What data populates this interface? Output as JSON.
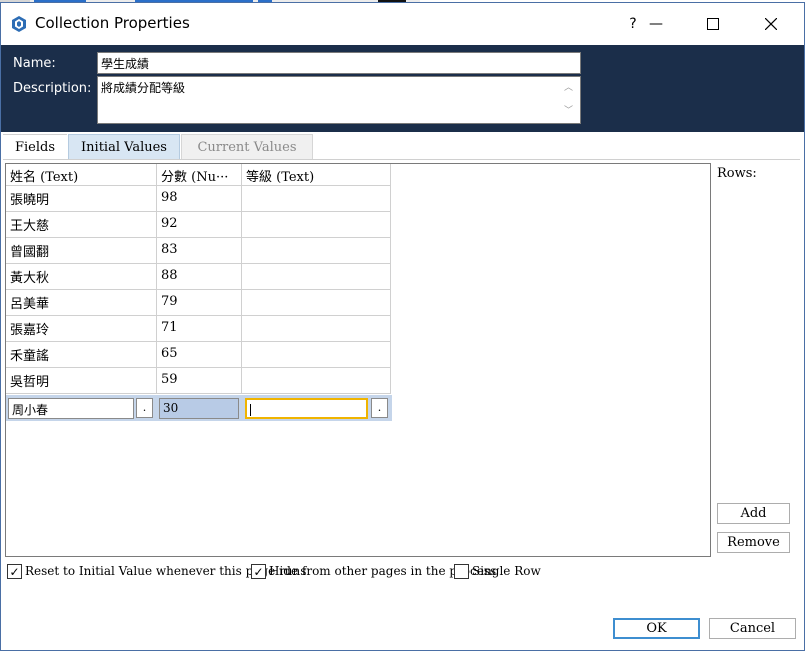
{
  "window": {
    "title": "Collection Properties",
    "help_label": "?",
    "minimize_glyph": "—",
    "maximize_glyph": "☐",
    "close_glyph": "✕"
  },
  "header": {
    "name_label": "Name:",
    "name_value": "學生成績",
    "description_label": "Description:",
    "description_value": "將成績分配等級"
  },
  "tabs": [
    {
      "label": "Fields",
      "state": "normal"
    },
    {
      "label": "Initial Values",
      "state": "selected"
    },
    {
      "label": "Current Values",
      "state": "disabled"
    }
  ],
  "grid": {
    "columns": [
      "姓名 (Text)",
      "分數 (Nu···",
      "等級 (Text)"
    ],
    "rows": [
      [
        "張曉明",
        "98",
        ""
      ],
      [
        "王大慈",
        "92",
        ""
      ],
      [
        "曾國翻",
        "83",
        ""
      ],
      [
        "黃大秋",
        "88",
        ""
      ],
      [
        "呂美華",
        "79",
        ""
      ],
      [
        "張嘉玲",
        "71",
        ""
      ],
      [
        "禾童謠",
        "65",
        ""
      ],
      [
        "吳哲明",
        "59",
        ""
      ]
    ],
    "edit_row": [
      "周小春",
      "30",
      ""
    ],
    "ellipsis_button_label": "."
  },
  "side": {
    "rows_label": "Rows:",
    "add_label": "Add",
    "remove_label": "Remove"
  },
  "options": {
    "reset_label": "Reset to Initial Value whenever this page runs",
    "reset_checked": true,
    "hide_label": "Hide from other pages in the process",
    "hide_checked": true,
    "single_row_label": "Single Row",
    "single_row_checked": false,
    "check_glyph": "✓"
  },
  "footer": {
    "ok_label": "OK",
    "cancel_label": "Cancel"
  },
  "colors": {
    "header_band": "#1b2e4a",
    "selected_tab": "#d8e6f3",
    "edit_row": "#c5d5ea",
    "active_cell_border": "#f0b400",
    "ok_border": "#3e8ed0"
  }
}
